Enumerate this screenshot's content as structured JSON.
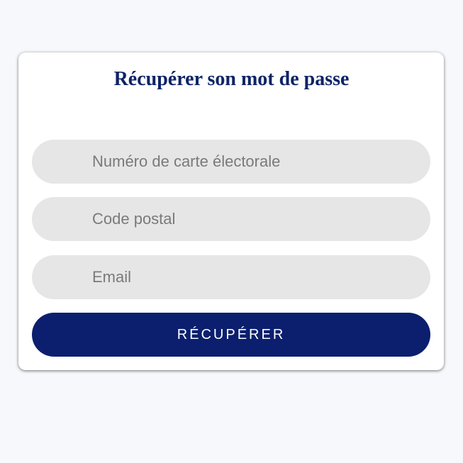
{
  "form": {
    "title": "Récupérer son mot de passe",
    "fields": {
      "card_number": {
        "placeholder": "Numéro de carte électorale",
        "value": ""
      },
      "postal_code": {
        "placeholder": "Code postal",
        "value": ""
      },
      "email": {
        "placeholder": "Email",
        "value": ""
      }
    },
    "submit_label": "RÉCUPÉRER"
  },
  "colors": {
    "page_background": "#f7f8fb",
    "card_background": "#ffffff",
    "title": "#0e2467",
    "input_background": "#e6e6e6",
    "button_background": "#0b1f6e",
    "button_text": "#ffffff"
  }
}
